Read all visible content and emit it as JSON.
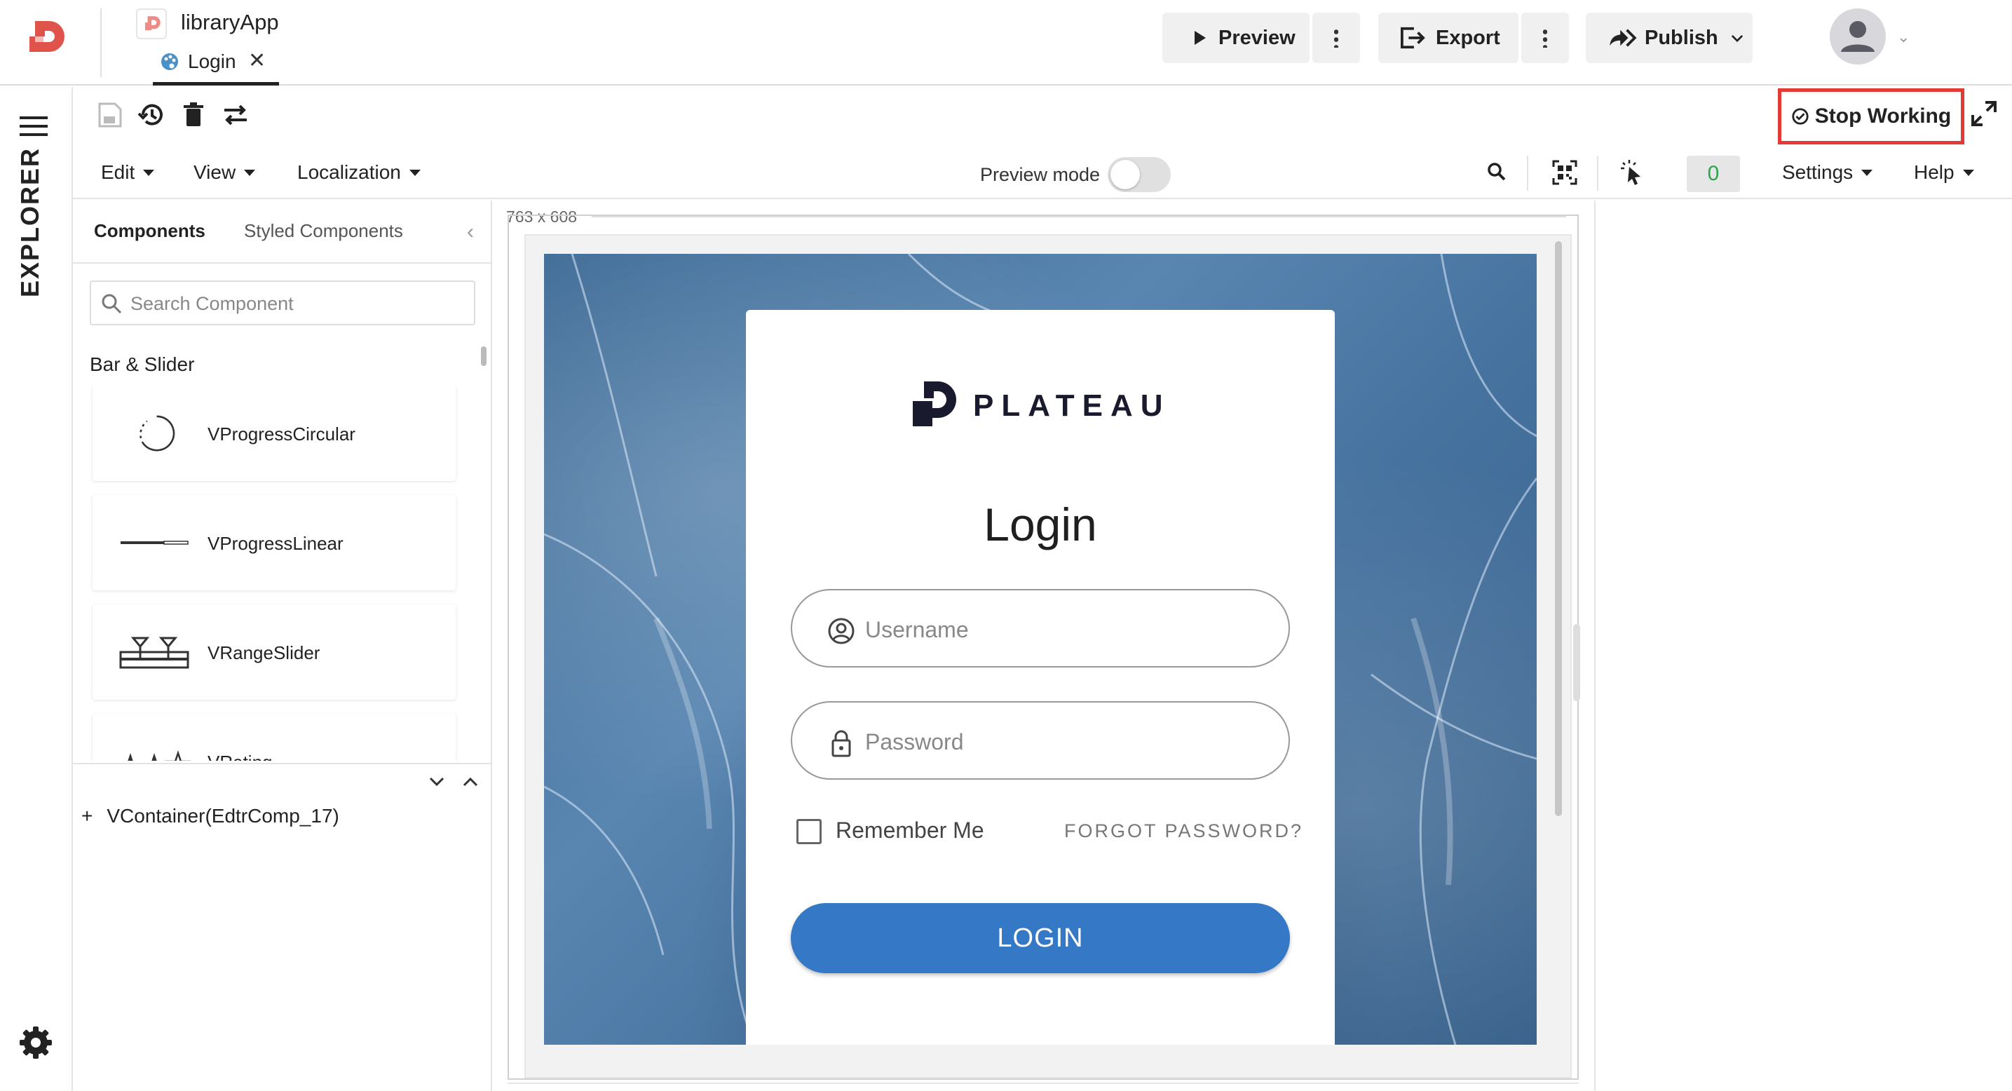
{
  "app": {
    "title": "libraryApp"
  },
  "tabs": [
    {
      "label": "Login"
    }
  ],
  "header": {
    "preview_label": "Preview",
    "export_label": "Export",
    "publish_label": "Publish"
  },
  "rail": {
    "explorer_label": "EXPLORER"
  },
  "toolbar": {
    "stop_working_label": "Stop Working"
  },
  "menu": {
    "edit": "Edit",
    "view": "View",
    "localization": "Localization",
    "preview_mode_label": "Preview mode",
    "preview_mode_on": false,
    "counter": "0",
    "settings": "Settings",
    "help": "Help"
  },
  "explorer": {
    "tabs": {
      "components": "Components",
      "styled": "Styled Components"
    },
    "search_placeholder": "Search Component",
    "category": "Bar & Slider",
    "components": [
      {
        "label": "VProgressCircular",
        "icon": "progress-circular-icon"
      },
      {
        "label": "VProgressLinear",
        "icon": "progress-linear-icon"
      },
      {
        "label": "VRangeSlider",
        "icon": "range-slider-icon"
      },
      {
        "label": "VRating",
        "icon": "rating-icon"
      }
    ],
    "tree": {
      "expand_symbol": "+",
      "node_label": "VContainer(EdtrComp_17)"
    }
  },
  "canvas": {
    "dimensions": "763 x 608"
  },
  "login_preview": {
    "brand": "PLATEAU",
    "heading": "Login",
    "username_placeholder": "Username",
    "password_placeholder": "Password",
    "remember_me": "Remember Me",
    "forgot_password": "FORGOT PASSWORD?",
    "login_button": "LOGIN"
  },
  "colors": {
    "brand_red": "#e0534a",
    "stop_working_border": "#e53935",
    "login_button": "#3478c6",
    "counter_text": "#2ea44f"
  }
}
